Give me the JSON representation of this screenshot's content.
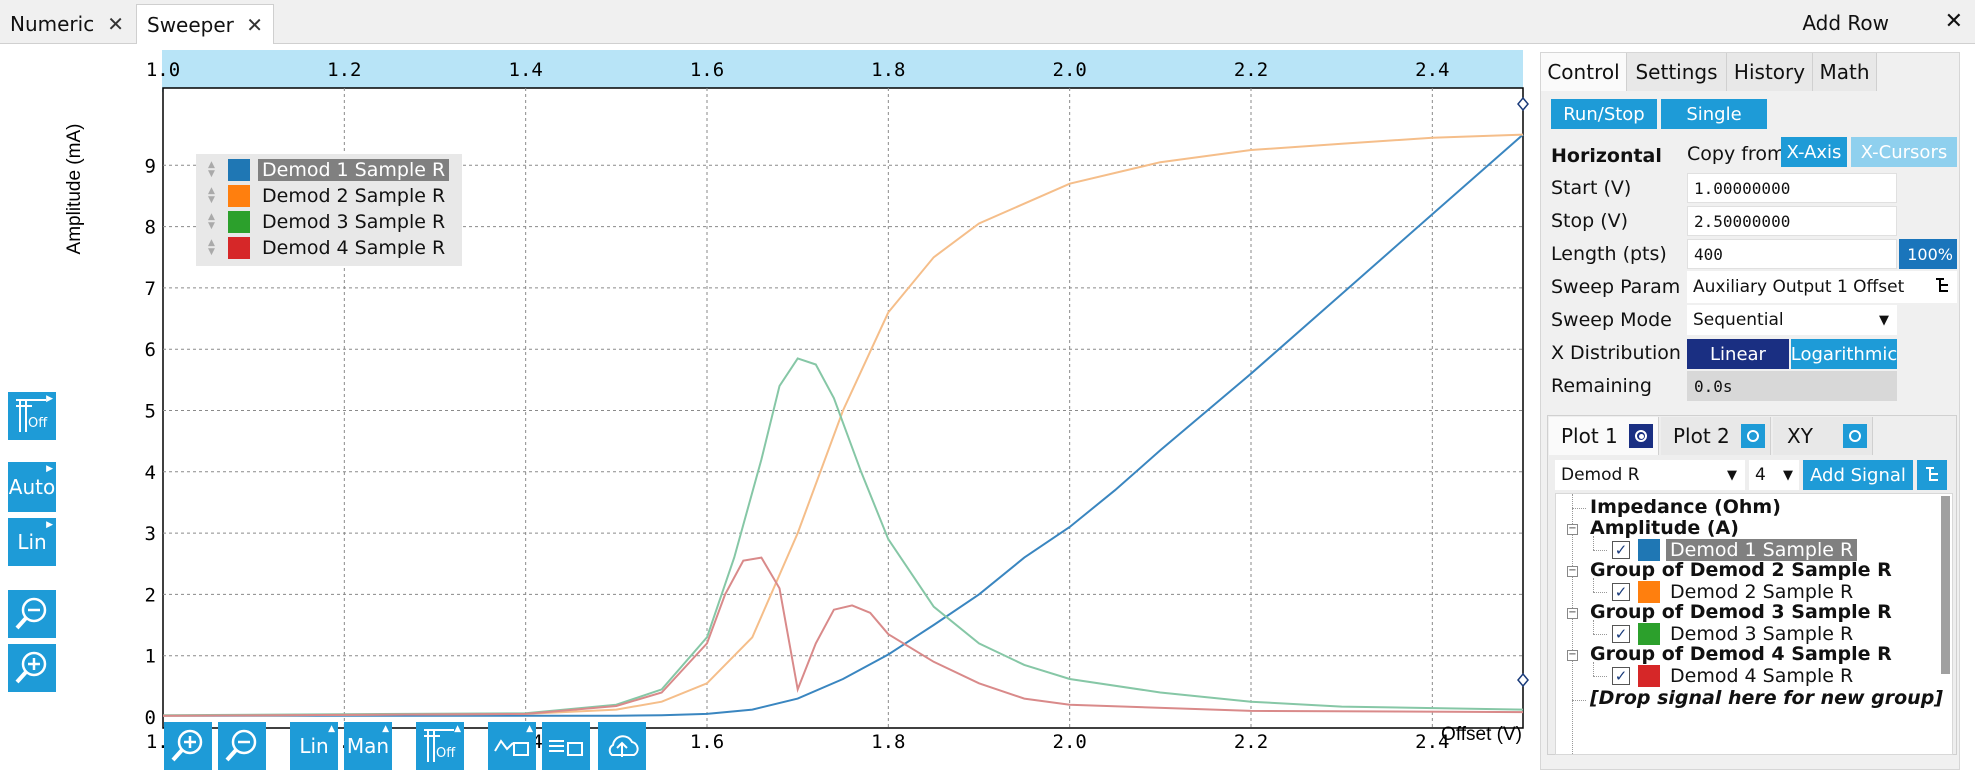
{
  "tabs": [
    {
      "label": "Numeric",
      "close": "✕"
    },
    {
      "label": "Sweeper",
      "close": "✕"
    }
  ],
  "tabbar": {
    "add_row": "Add Row",
    "close": "✕"
  },
  "plot": {
    "y_label": "Amplitude (mA)",
    "x_label": "Offset (V)",
    "top_ticks": [
      "1.0",
      "1.2",
      "1.4",
      "1.6",
      "1.8",
      "2.0",
      "2.2",
      "2.4"
    ],
    "bottom_ticks": [
      "1.0",
      "1.2",
      "1.4",
      "1.6",
      "1.8",
      "2.0",
      "2.2",
      "2.4"
    ],
    "y_ticks": [
      "0",
      "1",
      "2",
      "3",
      "4",
      "5",
      "6",
      "7",
      "8",
      "9"
    ],
    "legend": [
      {
        "label": "Demod 1 Sample R",
        "color": "#1f77b4"
      },
      {
        "label": "Demod 2 Sample R",
        "color": "#ff7f0e"
      },
      {
        "label": "Demod 3 Sample R",
        "color": "#2ca02c"
      },
      {
        "label": "Demod 4 Sample R",
        "color": "#d62728"
      }
    ]
  },
  "chart_data": {
    "type": "line",
    "xlabel": "Offset (V)",
    "ylabel": "Amplitude (mA)",
    "xlim": [
      1.0,
      2.5
    ],
    "ylim": [
      0,
      9.8
    ],
    "grid": true,
    "legend_position": "top-left",
    "series": [
      {
        "name": "Demod 1 Sample R",
        "color": "#1f77b4",
        "x": [
          1.0,
          1.5,
          1.55,
          1.6,
          1.65,
          1.7,
          1.75,
          1.8,
          1.85,
          1.9,
          1.95,
          2.0,
          2.05,
          2.1,
          2.2,
          2.3,
          2.4,
          2.5
        ],
        "y": [
          0.02,
          0.02,
          0.03,
          0.05,
          0.12,
          0.3,
          0.62,
          1.02,
          1.5,
          2.0,
          2.6,
          3.1,
          3.7,
          4.35,
          5.6,
          6.9,
          8.2,
          9.5
        ]
      },
      {
        "name": "Demod 2 Sample R",
        "color": "#ff7f0e",
        "x": [
          1.0,
          1.4,
          1.5,
          1.55,
          1.6,
          1.65,
          1.7,
          1.75,
          1.8,
          1.85,
          1.9,
          2.0,
          2.1,
          2.2,
          2.3,
          2.4,
          2.5
        ],
        "y": [
          0.02,
          0.05,
          0.12,
          0.25,
          0.55,
          1.3,
          3.0,
          5.0,
          6.6,
          7.5,
          8.05,
          8.7,
          9.05,
          9.25,
          9.35,
          9.45,
          9.5
        ]
      },
      {
        "name": "Demod 3 Sample R",
        "color": "#2ca02c",
        "x": [
          1.0,
          1.4,
          1.5,
          1.55,
          1.6,
          1.63,
          1.66,
          1.68,
          1.7,
          1.72,
          1.74,
          1.77,
          1.8,
          1.85,
          1.9,
          1.95,
          2.0,
          2.1,
          2.2,
          2.3,
          2.5
        ],
        "y": [
          0.03,
          0.06,
          0.2,
          0.45,
          1.3,
          2.6,
          4.2,
          5.4,
          5.85,
          5.75,
          5.2,
          4.0,
          2.9,
          1.8,
          1.2,
          0.85,
          0.62,
          0.4,
          0.25,
          0.17,
          0.12
        ]
      },
      {
        "name": "Demod 4 Sample R",
        "color": "#d62728",
        "x": [
          1.0,
          1.4,
          1.5,
          1.55,
          1.6,
          1.62,
          1.64,
          1.66,
          1.68,
          1.7,
          1.72,
          1.74,
          1.76,
          1.78,
          1.8,
          1.85,
          1.9,
          1.95,
          2.0,
          2.2,
          2.5
        ],
        "y": [
          0.02,
          0.05,
          0.18,
          0.4,
          1.2,
          2.0,
          2.55,
          2.6,
          2.1,
          0.45,
          1.2,
          1.75,
          1.82,
          1.7,
          1.35,
          0.9,
          0.55,
          0.3,
          0.2,
          0.1,
          0.08
        ]
      }
    ]
  },
  "left_toolbar": {
    "grid_off": "Off",
    "auto": "Auto",
    "lin": "Lin"
  },
  "bottom_toolbar": {
    "lin": "Lin",
    "man": "Man",
    "off": "Off"
  },
  "panel": {
    "tabs": [
      "Control",
      "Settings",
      "History",
      "Math"
    ],
    "run_stop": "Run/Stop",
    "single": "Single",
    "horizontal": "Horizontal",
    "copy_from": "Copy from",
    "x_axis": "X-Axis",
    "x_cursors": "X-Cursors",
    "start_label": "Start  (V)",
    "start_value": "1.00000000",
    "stop_label": "Stop  (V)",
    "stop_value": "2.50000000",
    "length_label": "Length (pts)",
    "length_value": "400",
    "length_pct": "100%",
    "sweep_param_label": "Sweep Param",
    "sweep_param_value": "Auxiliary Output 1 Offset",
    "sweep_mode_label": "Sweep Mode",
    "sweep_mode_value": "Sequential",
    "xdist_label": "X Distribution",
    "linear": "Linear",
    "logarithmic": "Logarithmic",
    "remaining_label": "Remaining",
    "remaining_value": "0.0s",
    "plot_tabs": [
      "Plot 1",
      "Plot 2",
      "XY"
    ],
    "signal_select": "Demod R",
    "count_select": "4",
    "add_signal": "Add Signal",
    "tree": {
      "impedance": "Impedance (Ohm)",
      "amplitude": "Amplitude (A)",
      "d1": "Demod 1 Sample R",
      "g2": "Group of Demod 2 Sample R",
      "d2": "Demod 2 Sample R",
      "g3": "Group of Demod 3 Sample R",
      "d3": "Demod 3 Sample R",
      "g4": "Group of Demod 4 Sample R",
      "d4": "Demod 4 Sample R",
      "drop": "[Drop signal here for new group]"
    }
  }
}
